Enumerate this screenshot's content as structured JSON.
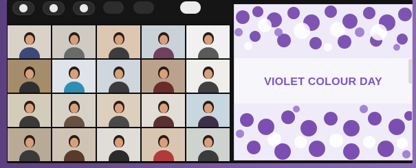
{
  "slide": {
    "title": "VIOLET COLOUR DAY",
    "accent": "#7a55c6"
  },
  "participants_strip": [
    {
      "icon": "avatar-icon"
    },
    {
      "icon": "avatar-icon"
    },
    {
      "icon": "avatar-icon"
    },
    {
      "icon": "avatar-icon"
    },
    {
      "icon": "avatar-icon"
    },
    {
      "icon": "avatar-icon"
    }
  ],
  "grid": {
    "rows": 4,
    "cols": 5,
    "tiles": [
      {
        "bg": "#d9d2c7",
        "shirt": "#3b4a7a"
      },
      {
        "bg": "#cfcac2",
        "shirt": "#6a6a6a"
      },
      {
        "bg": "#dcc7b2",
        "shirt": "#3d3d3d"
      },
      {
        "bg": "#c9d1d9",
        "shirt": "#704060"
      },
      {
        "bg": "#f1f1f1",
        "shirt": "#5a5a5a"
      },
      {
        "bg": "#a58d6b",
        "shirt": "#2f2f2f"
      },
      {
        "bg": "#dfe3ea",
        "shirt": "#2e8fb2"
      },
      {
        "bg": "#cfd7de",
        "shirt": "#3b3b3b"
      },
      {
        "bg": "#bba28c",
        "shirt": "#6b2b2b"
      },
      {
        "bg": "#efeeea",
        "shirt": "#404040"
      },
      {
        "bg": "#d3ccb9",
        "shirt": "#3a3a3a"
      },
      {
        "bg": "#d7d2c8",
        "shirt": "#6a5040"
      },
      {
        "bg": "#dccfbd",
        "shirt": "#4a4a4a"
      },
      {
        "bg": "#e2ddd6",
        "shirt": "#5a2f2f"
      },
      {
        "bg": "#c8d6df",
        "shirt": "#3c2f4a"
      },
      {
        "bg": "#b9aa98",
        "shirt": "#3a3a3a"
      },
      {
        "bg": "#cfc3b5",
        "shirt": "#5a3a2a"
      },
      {
        "bg": "#e0ddd8",
        "shirt": "#2b2b2b"
      },
      {
        "bg": "#d8c6b2",
        "shirt": "#b23a3a"
      },
      {
        "bg": "#cfd3cf",
        "shirt": "#3b3b3b"
      }
    ]
  }
}
